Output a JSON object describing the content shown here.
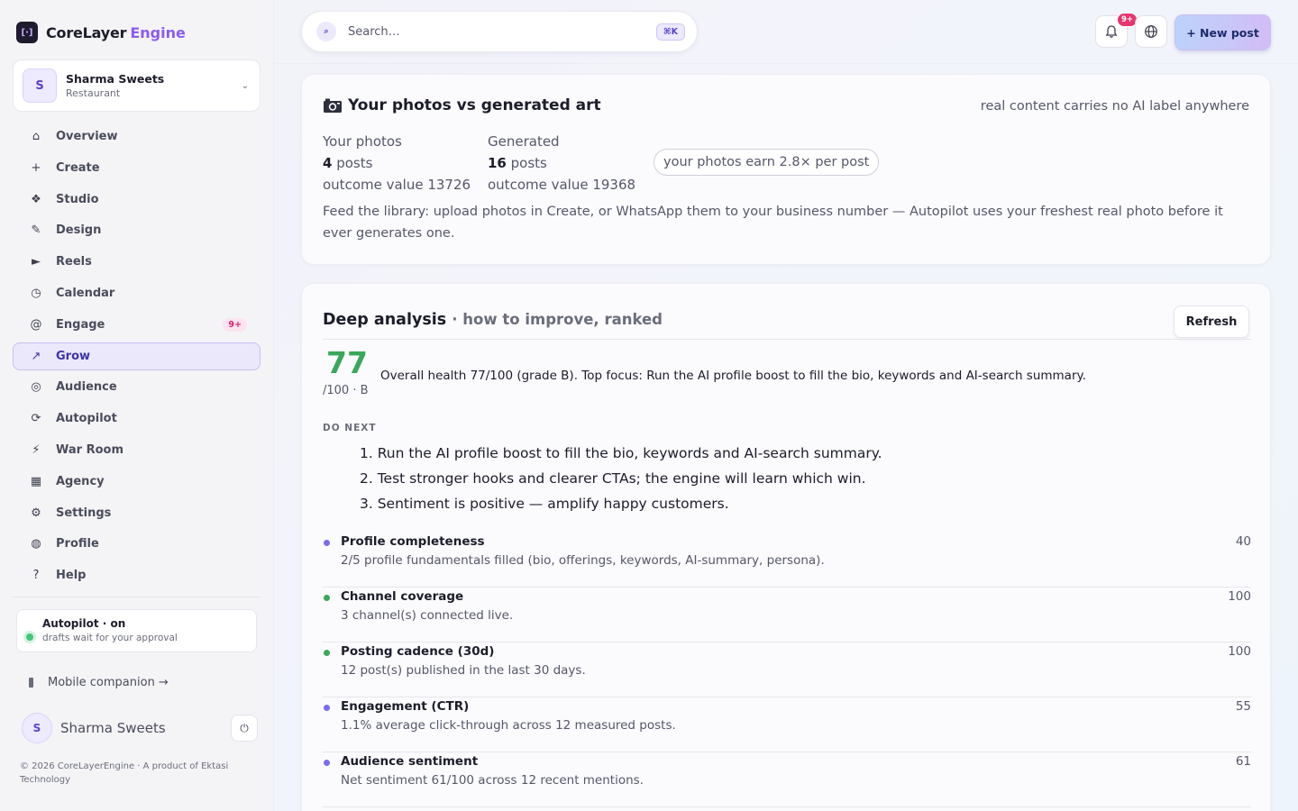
{
  "brand": {
    "name": "CoreLayer",
    "accent": "Engine",
    "logo_glyph": "[·]"
  },
  "workspace": {
    "avatar": "S",
    "name": "Sharma Sweets",
    "type": "Restaurant",
    "chevron": "⌄"
  },
  "nav": [
    {
      "icon": "⌂",
      "label": "Overview"
    },
    {
      "icon": "+",
      "label": "Create"
    },
    {
      "icon": "❖",
      "label": "Studio"
    },
    {
      "icon": "✎",
      "label": "Design"
    },
    {
      "icon": "►",
      "label": "Reels"
    },
    {
      "icon": "◷",
      "label": "Calendar"
    },
    {
      "icon": "@",
      "label": "Engage",
      "badge": "9+"
    },
    {
      "icon": "↗",
      "label": "Grow",
      "active": true
    },
    {
      "icon": "◎",
      "label": "Audience"
    },
    {
      "icon": "⟳",
      "label": "Autopilot"
    },
    {
      "icon": "⚡",
      "label": "War Room"
    },
    {
      "icon": "▦",
      "label": "Agency"
    },
    {
      "icon": "⚙",
      "label": "Settings"
    },
    {
      "icon": "◍",
      "label": "Profile"
    },
    {
      "icon": "?",
      "label": "Help"
    }
  ],
  "autopilot": {
    "title": "Autopilot · on",
    "subtitle": "drafts wait for your approval"
  },
  "mobile_link": "Mobile companion →",
  "user": {
    "avatar": "S",
    "name": "Sharma Sweets",
    "logout_icon": "⏻"
  },
  "footer": "© 2026 CoreLayerEngine · A product of Ektasi Technology",
  "search": {
    "placeholder": "Search…",
    "icon": "⌕",
    "shortcut": "⌘K"
  },
  "topbar": {
    "notif_count": "9+",
    "bell_icon": "🔔",
    "globe_icon": "🌐",
    "new_post": "+ New post"
  },
  "photos_card": {
    "title": "Your photos vs generated art",
    "note": "real content carries no AI label anywhere",
    "yours": {
      "label": "Your photos",
      "count": "4",
      "unit": "posts",
      "outcome": "outcome value 13726"
    },
    "generated": {
      "label": "Generated",
      "count": "16",
      "unit": "posts",
      "outcome": "outcome value 19368"
    },
    "pill": "your photos earn 2.8× per post",
    "feed_note": "Feed the library: upload photos in Create, or WhatsApp them to your business number — Autopilot uses your freshest real photo before it ever generates one."
  },
  "analysis": {
    "title": "Deep analysis",
    "subtitle": "· how to improve, ranked",
    "refresh": "Refresh",
    "score": "77",
    "score_sub": "/100 · B",
    "summary": "Overall health 77/100 (grade B). Top focus: Run the AI profile boost to fill the bio, keywords and AI-search summary.",
    "do_next_label": "DO NEXT",
    "do_next": [
      "1. Run the AI profile boost to fill the bio, keywords and AI-search summary.",
      "2. Test stronger hooks and clearer CTAs; the engine will learn which win.",
      "3. Sentiment is positive — amplify happy customers."
    ],
    "metrics": [
      {
        "title": "Profile completeness",
        "desc": "2/5 profile fundamentals filled (bio, offerings, keywords, AI-summary, persona).",
        "score": "40",
        "color": "#7c6cf0"
      },
      {
        "title": "Channel coverage",
        "desc": "3 channel(s) connected live.",
        "score": "100",
        "color": "#3aa85b"
      },
      {
        "title": "Posting cadence (30d)",
        "desc": "12 post(s) published in the last 30 days.",
        "score": "100",
        "color": "#3aa85b"
      },
      {
        "title": "Engagement (CTR)",
        "desc": "1.1% average click-through across 12 measured posts.",
        "score": "55",
        "color": "#7c6cf0"
      },
      {
        "title": "Audience sentiment",
        "desc": "Net sentiment 61/100 across 12 recent mentions.",
        "score": "61",
        "color": "#7c6cf0"
      }
    ]
  }
}
